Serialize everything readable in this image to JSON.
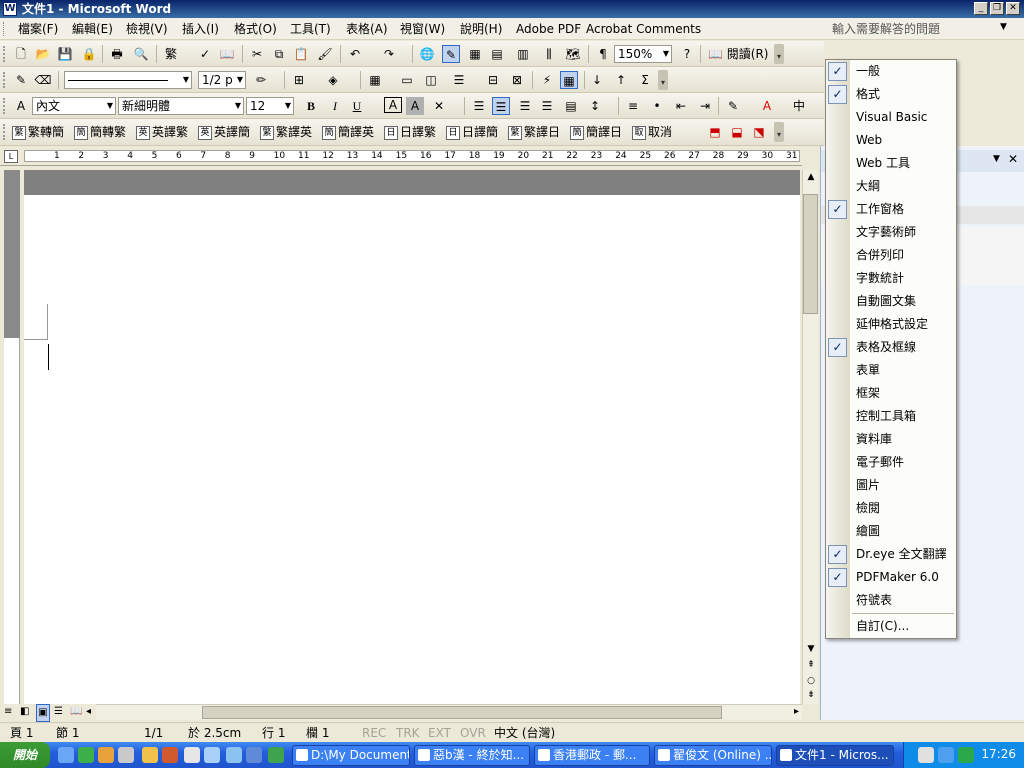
{
  "window": {
    "title": "文件1 - Microsoft Word",
    "minimize": "_",
    "restore": "❐",
    "close": "✕"
  },
  "menubar": {
    "items": [
      "檔案(F)",
      "編輯(E)",
      "檢視(V)",
      "插入(I)",
      "格式(O)",
      "工具(T)",
      "表格(A)",
      "視窗(W)",
      "說明(H)",
      "Adobe PDF",
      "Acrobat Comments"
    ],
    "help_placeholder": "輸入需要解答的問題"
  },
  "toolbar_standard": {
    "zoom": "150%",
    "read_label": "閱讀(R)"
  },
  "toolbar_tables": {
    "line_weight": "1/2 p"
  },
  "toolbar_formatting": {
    "style": "內文",
    "font": "新細明體",
    "size": "12",
    "bold": "B",
    "italic": "I",
    "underline": "U",
    "font_color": "A",
    "char_border": "A",
    "sigma": "Σ"
  },
  "toolbar_translate": {
    "items": [
      {
        "badge": "繁",
        "label": "繁轉簡"
      },
      {
        "badge": "簡",
        "label": "簡轉繁"
      },
      {
        "badge": "英",
        "label": "英譯繁"
      },
      {
        "badge": "英",
        "label": "英譯簡"
      },
      {
        "badge": "繁",
        "label": "繁譯英"
      },
      {
        "badge": "簡",
        "label": "簡譯英"
      },
      {
        "badge": "日",
        "label": "日譯繁"
      },
      {
        "badge": "日",
        "label": "日譯簡"
      },
      {
        "badge": "繁",
        "label": "繁譯日"
      },
      {
        "badge": "簡",
        "label": "簡譯日"
      },
      {
        "badge": "取",
        "label": "取消"
      }
    ]
  },
  "ruler": {
    "ticks": [
      "1",
      "2",
      "3",
      "4",
      "5",
      "6",
      "7",
      "8",
      "9",
      "10",
      "11",
      "12",
      "13",
      "14",
      "15",
      "16",
      "17",
      "18",
      "19",
      "20",
      "21",
      "22",
      "23",
      "24",
      "25",
      "26",
      "27",
      "28",
      "29",
      "30",
      "31"
    ]
  },
  "context_menu": {
    "items": [
      {
        "label": "一般",
        "checked": true
      },
      {
        "label": "格式",
        "checked": true
      },
      {
        "label": "Visual Basic",
        "checked": false
      },
      {
        "label": "Web",
        "checked": false
      },
      {
        "label": "Web 工具",
        "checked": false
      },
      {
        "label": "大綱",
        "checked": false
      },
      {
        "label": "工作窗格",
        "checked": true
      },
      {
        "label": "文字藝術師",
        "checked": false
      },
      {
        "label": "合併列印",
        "checked": false
      },
      {
        "label": "字數統計",
        "checked": false
      },
      {
        "label": "自動圖文集",
        "checked": false
      },
      {
        "label": "延伸格式設定",
        "checked": false
      },
      {
        "label": "表格及框線",
        "checked": true
      },
      {
        "label": "表單",
        "checked": false
      },
      {
        "label": "框架",
        "checked": false
      },
      {
        "label": "控制工具箱",
        "checked": false
      },
      {
        "label": "資料庫",
        "checked": false
      },
      {
        "label": "電子郵件",
        "checked": false
      },
      {
        "label": "圖片",
        "checked": false
      },
      {
        "label": "檢閱",
        "checked": false
      },
      {
        "label": "繪圖",
        "checked": false
      },
      {
        "label": "Dr.eye 全文翻譯",
        "checked": true
      },
      {
        "label": "PDFMaker 6.0",
        "checked": true
      },
      {
        "label": "符號表",
        "checked": false
      }
    ],
    "customize": "自訂(C)..."
  },
  "statusbar": {
    "page": "頁 1",
    "section": "節 1",
    "page_of": "1/1",
    "at": "於 2.5cm",
    "line": "行 1",
    "col": "欄 1",
    "rec": "REC",
    "trk": "TRK",
    "ext": "EXT",
    "ovr": "OVR",
    "language": "中文 (台灣)"
  },
  "taskbar": {
    "start": "開始",
    "buttons": [
      "D:\\My Document...",
      "惡b漢 - 終於知...",
      "香港郵政 - 郵...",
      "翟俊文 (Online) ...",
      "文件1 - Micros..."
    ],
    "clock": "17:26"
  }
}
